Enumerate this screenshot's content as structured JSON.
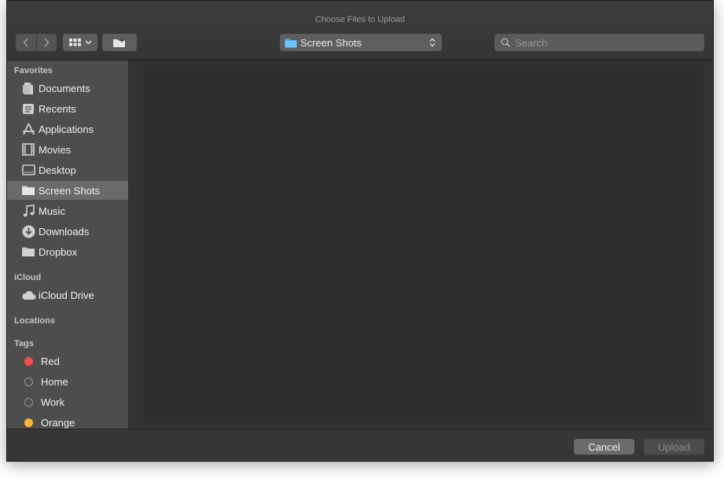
{
  "window": {
    "title": "Choose Files to Upload"
  },
  "toolbar": {
    "back_icon": "chevron-left-icon",
    "forward_icon": "chevron-right-icon",
    "view_icon": "grid-view-icon",
    "new_folder_icon": "new-folder-icon",
    "location": {
      "label": "Screen Shots",
      "icon": "folder-icon",
      "folder_color": "#4fb3f6"
    },
    "search": {
      "placeholder": "Search",
      "value": ""
    }
  },
  "sidebar": {
    "sections": {
      "favorites": "Favorites",
      "icloud": "iCloud",
      "locations": "Locations",
      "tags": "Tags"
    },
    "favorites": [
      {
        "label": "Documents",
        "icon": "document-icon"
      },
      {
        "label": "Recents",
        "icon": "recents-icon"
      },
      {
        "label": "Applications",
        "icon": "applications-icon"
      },
      {
        "label": "Movies",
        "icon": "film-icon"
      },
      {
        "label": "Desktop",
        "icon": "desktop-icon"
      },
      {
        "label": "Screen Shots",
        "icon": "folder-icon",
        "selected": true
      },
      {
        "label": "Music",
        "icon": "music-note-icon"
      },
      {
        "label": "Downloads",
        "icon": "download-icon"
      },
      {
        "label": "Dropbox",
        "icon": "folder-icon"
      }
    ],
    "icloud": [
      {
        "label": "iCloud Drive",
        "icon": "cloud-icon"
      }
    ],
    "tags": [
      {
        "label": "Red",
        "color": "#fc4d4d"
      },
      {
        "label": "Home",
        "color": "none"
      },
      {
        "label": "Work",
        "color": "none"
      },
      {
        "label": "Orange",
        "color": "#fdb52c"
      }
    ]
  },
  "footer": {
    "cancel_label": "Cancel",
    "upload_label": "Upload"
  }
}
